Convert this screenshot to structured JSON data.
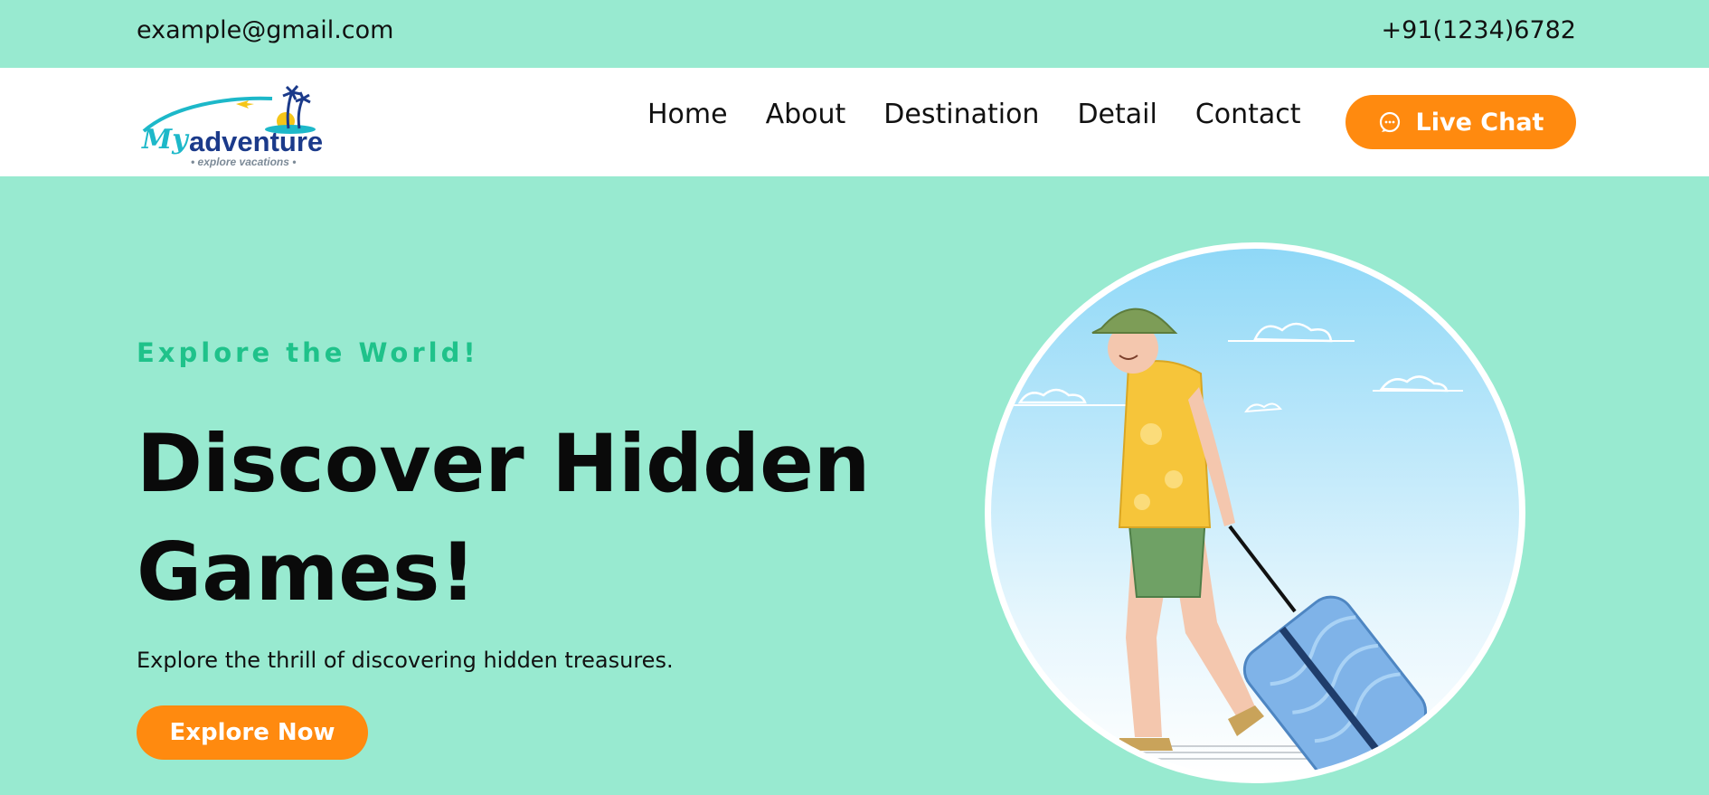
{
  "topbar": {
    "email": "example@gmail.com",
    "phone": "+91(1234)6782"
  },
  "logo": {
    "script_word": "My",
    "word": "adventure",
    "tagline": "• explore vacations •"
  },
  "nav": {
    "items": [
      {
        "label": "Home"
      },
      {
        "label": "About"
      },
      {
        "label": "Destination"
      },
      {
        "label": "Detail"
      },
      {
        "label": "Contact"
      }
    ],
    "cta_label": "Live Chat"
  },
  "hero": {
    "eyebrow": "Explore the World!",
    "headline_line1": "Discover Hidden",
    "headline_line2": "Games!",
    "subtext": "Explore the thrill of discovering hidden treasures.",
    "button_label": "Explore Now",
    "illustration": "traveler-with-suitcase"
  },
  "colors": {
    "background": "#98EAD0",
    "accent": "#FF8A0F",
    "eyebrow": "#1FC28A",
    "navbar": "#FFFFFF"
  }
}
